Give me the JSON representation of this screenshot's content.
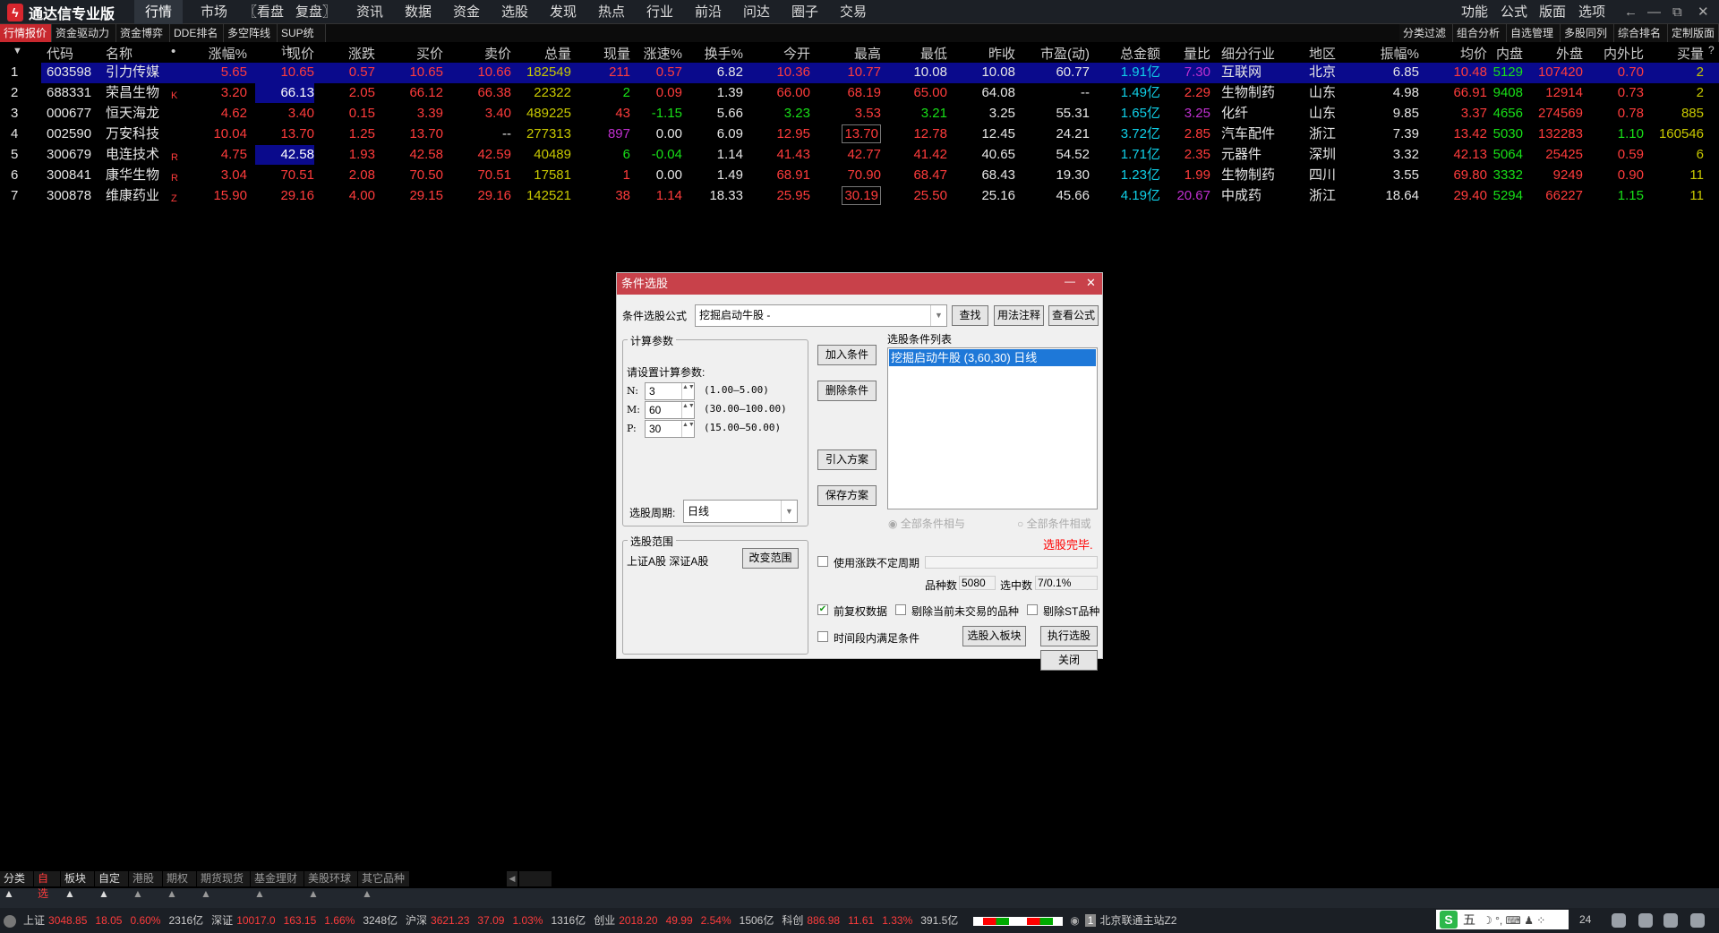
{
  "app": {
    "title": "通达信专业版",
    "logo_glyph": "ϟ"
  },
  "menu": {
    "items": [
      "行情",
      "市场",
      "〖看盘",
      "复盘〗",
      "资讯",
      "数据",
      "资金",
      "选股",
      "发现",
      "热点",
      "行业",
      "前沿",
      "问达",
      "圈子",
      "交易"
    ],
    "right": [
      "功能",
      "公式",
      "版面",
      "选项"
    ]
  },
  "window_controls": {
    "back": "←",
    "min": "—",
    "restore": "⧉",
    "close": "✕"
  },
  "subtabs": {
    "left": [
      "行情报价",
      "资金驱动力",
      "资金博弈",
      "DDE排名",
      "多空阵线",
      "SUP统计"
    ],
    "right": [
      "分类过滤",
      "组合分析",
      "自选管理",
      "多股同列",
      "综合排名",
      "定制版面"
    ]
  },
  "table": {
    "sort_icon": "▼",
    "help": "?",
    "headers": [
      "",
      "代码",
      "名称",
      "•",
      "涨幅%",
      "现价",
      "涨跌",
      "买价",
      "卖价",
      "总量",
      "现量",
      "涨速%",
      "换手%",
      "今开",
      "最高",
      "最低",
      "昨收",
      "市盈(动)",
      "总金额",
      "量比",
      "细分行业",
      "地区",
      "振幅%",
      "均价",
      "内盘",
      "外盘",
      "内外比",
      "买量"
    ],
    "rows": [
      {
        "cells": [
          "1",
          "603598",
          "引力传媒",
          "",
          "5.65",
          "10.65",
          "0.57",
          "10.65",
          "10.66",
          "182549",
          "211",
          "0.57",
          "6.82",
          "10.36",
          "10.77",
          "10.08",
          "10.08",
          "60.77",
          "1.91亿",
          "7.30",
          "互联网",
          "北京",
          "6.85",
          "10.48",
          "5129",
          "107420",
          "0.70",
          "2"
        ],
        "colors": "wwwrrrrrryrrwrrwwwcmwwwrgrry",
        "selected": true
      },
      {
        "cells": [
          "2",
          "688331",
          "荣昌生物",
          "K",
          "3.20",
          "66.13",
          "2.05",
          "66.12",
          "66.38",
          "22322",
          "2",
          "0.09",
          "1.39",
          "66.00",
          "68.19",
          "65.00",
          "64.08",
          "--",
          "1.49亿",
          "2.29",
          "生物制药",
          "山东",
          "4.98",
          "66.91",
          "9408",
          "12914",
          "0.73",
          "2"
        ],
        "colors": "wwwrrwrrrygrwrrrwwcrwwwrgrry",
        "hl": 5
      },
      {
        "cells": [
          "3",
          "000677",
          "恒天海龙",
          "",
          "4.62",
          "3.40",
          "0.15",
          "3.39",
          "3.40",
          "489225",
          "43",
          "-1.15",
          "5.66",
          "3.23",
          "3.53",
          "3.21",
          "3.25",
          "55.31",
          "1.65亿",
          "3.25",
          "化纤",
          "山东",
          "9.85",
          "3.37",
          "4656",
          "274569",
          "0.78",
          "885"
        ],
        "colors": "wwwrrrrrryrgwgrgwwcmwwwrgrry"
      },
      {
        "cells": [
          "4",
          "002590",
          "万安科技",
          "",
          "10.04",
          "13.70",
          "1.25",
          "13.70",
          "--",
          "277313",
          "897",
          "0.00",
          "6.09",
          "12.95",
          "13.70",
          "12.78",
          "12.45",
          "24.21",
          "3.72亿",
          "2.85",
          "汽车配件",
          "浙江",
          "7.39",
          "13.42",
          "5030",
          "132283",
          "1.10",
          "160546"
        ],
        "colors": "wwwrrrrrwymwwrrrwwcrwwwrgrgy",
        "boxed": 14
      },
      {
        "cells": [
          "5",
          "300679",
          "电连技术",
          "R",
          "4.75",
          "42.58",
          "1.93",
          "42.58",
          "42.59",
          "40489",
          "6",
          "-0.04",
          "1.14",
          "41.43",
          "42.77",
          "41.42",
          "40.65",
          "54.52",
          "1.71亿",
          "2.35",
          "元器件",
          "深圳",
          "3.32",
          "42.13",
          "5064",
          "25425",
          "0.59",
          "6"
        ],
        "colors": "wwwrrwrrryggwrrrwwcrwwwrgrry",
        "hl": 5
      },
      {
        "cells": [
          "6",
          "300841",
          "康华生物",
          "R",
          "3.04",
          "70.51",
          "2.08",
          "70.50",
          "70.51",
          "17581",
          "1",
          "0.00",
          "1.49",
          "68.91",
          "70.90",
          "68.47",
          "68.43",
          "19.30",
          "1.23亿",
          "1.99",
          "生物制药",
          "四川",
          "3.55",
          "69.80",
          "3332",
          "9249",
          "0.90",
          "11"
        ],
        "colors": "wwwrrrrrryrwwrrrwwcrwwwrgrry"
      },
      {
        "cells": [
          "7",
          "300878",
          "维康药业",
          "Z",
          "15.90",
          "29.16",
          "4.00",
          "29.15",
          "29.16",
          "142521",
          "38",
          "1.14",
          "18.33",
          "25.95",
          "30.19",
          "25.50",
          "25.16",
          "45.66",
          "4.19亿",
          "20.67",
          "中成药",
          "浙江",
          "18.64",
          "29.40",
          "5294",
          "66227",
          "1.15",
          "11"
        ],
        "colors": "wwwrrrrrryrrwrrrwwcmwwwrgrgy",
        "boxed": 14
      }
    ]
  },
  "dialog": {
    "title": "条件选股",
    "min": "—",
    "close": "✕",
    "formula_label": "条件选股公式",
    "formula_value": "挖掘启动牛股 -",
    "find": "查找",
    "usage": "用法注释",
    "view_formula": "查看公式",
    "params_group": "计算参数",
    "params_prompt": "请设置计算参数:",
    "params": [
      {
        "name": "N:",
        "value": "3",
        "range": "(1.00—5.00)"
      },
      {
        "name": "M:",
        "value": "60",
        "range": "(30.00—100.00)"
      },
      {
        "name": "P:",
        "value": "30",
        "range": "(15.00—50.00)"
      }
    ],
    "period_label": "选股周期:",
    "period_value": "日线",
    "add": "加入条件",
    "delete": "删除条件",
    "import": "引入方案",
    "save": "保存方案",
    "list_label": "选股条件列表",
    "list_items": [
      "挖掘启动牛股 (3,60,30) 日线"
    ],
    "radio_and": "全部条件相与",
    "radio_or": "全部条件相或",
    "done": "选股完毕.",
    "range_group": "选股范围",
    "range_value": "上证A股 深证A股",
    "change_range": "改变范围",
    "use_period": "使用涨跌不定周期",
    "count_label": "品种数",
    "count_value": "5080",
    "selected_label": "选中数",
    "selected_value": "7/0.1%",
    "fq": "前复权数据",
    "fq_checked": true,
    "exclude_untraded": "剔除当前未交易的品种",
    "exclude_st": "剔除ST品种",
    "time_range": "时间段内满足条件",
    "to_block": "选股入板块",
    "execute": "执行选股",
    "close_btn": "关闭"
  },
  "bottom_tabs": [
    "分类▲",
    "自选",
    "板块▲",
    "自定▲",
    "港股▲",
    "期权▲",
    "期货现货▲",
    "基金理财▲",
    "美股环球▲",
    "其它品种▲"
  ],
  "status": {
    "items": [
      {
        "t": "上证",
        "c": "w"
      },
      {
        "t": "3048.85",
        "c": "r"
      },
      {
        "t": "18.05",
        "c": "r"
      },
      {
        "t": "0.60%",
        "c": "r"
      },
      {
        "t": "2316亿",
        "c": "w"
      },
      {
        "t": "深证",
        "c": "w"
      },
      {
        "t": "10017.0",
        "c": "r"
      },
      {
        "t": "163.15",
        "c": "r"
      },
      {
        "t": "1.66%",
        "c": "r"
      },
      {
        "t": "3248亿",
        "c": "w"
      },
      {
        "t": "沪深",
        "c": "w"
      },
      {
        "t": "3621.23",
        "c": "r"
      },
      {
        "t": "37.09",
        "c": "r"
      },
      {
        "t": "1.03%",
        "c": "r"
      },
      {
        "t": "1316亿",
        "c": "w"
      },
      {
        "t": "创业",
        "c": "w"
      },
      {
        "t": "2018.20",
        "c": "r"
      },
      {
        "t": "49.99",
        "c": "r"
      },
      {
        "t": "2.54%",
        "c": "r"
      },
      {
        "t": "1506亿",
        "c": "w"
      },
      {
        "t": "科创",
        "c": "w"
      },
      {
        "t": "886.98",
        "c": "r"
      },
      {
        "t": "11.61",
        "c": "r"
      },
      {
        "t": "1.33%",
        "c": "r"
      },
      {
        "t": "391.5亿",
        "c": "w"
      }
    ],
    "server": "北京联通主站Z2",
    "server_no": "1",
    "ime": "五",
    "time": "24"
  }
}
